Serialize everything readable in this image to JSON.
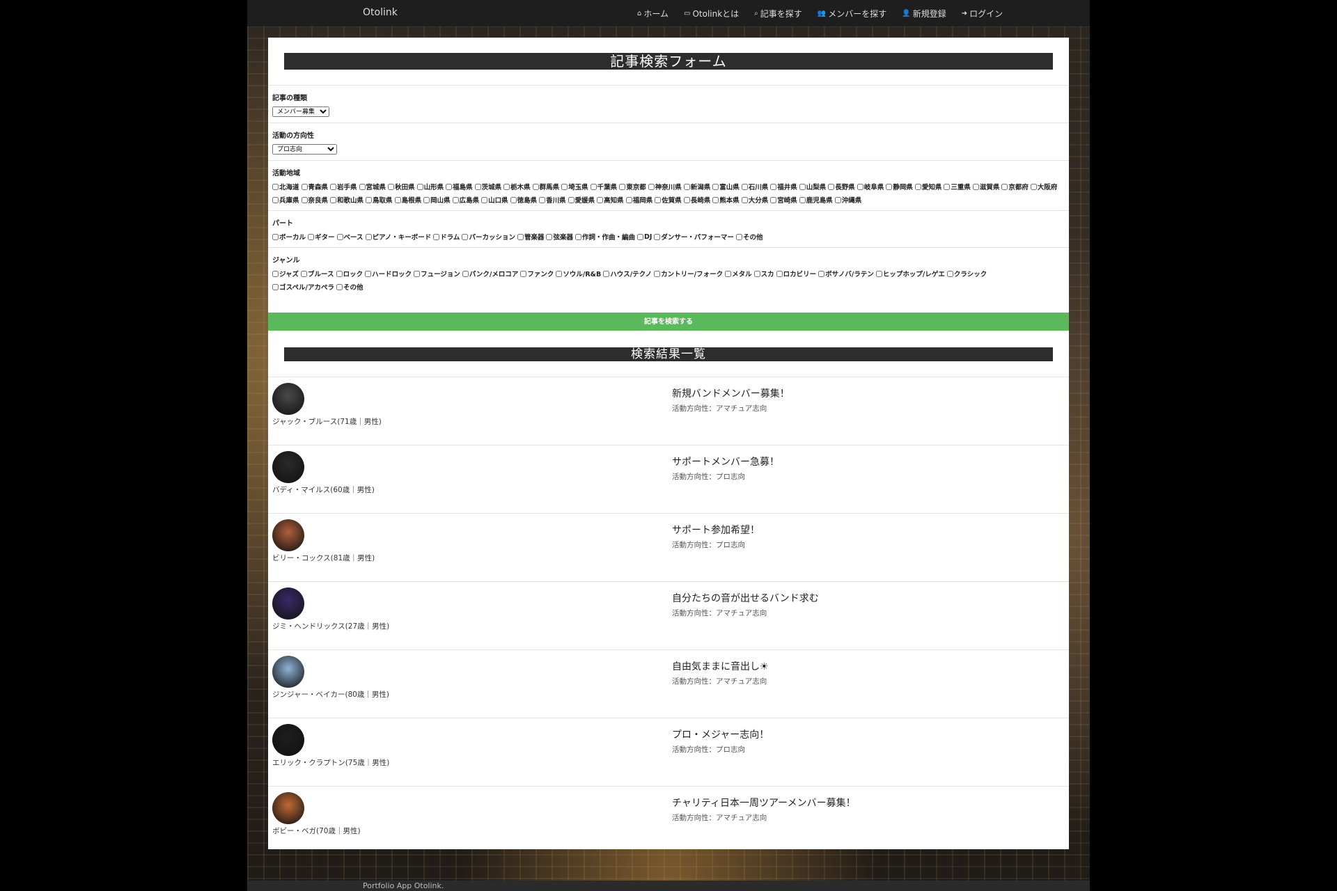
{
  "nav": {
    "brand": "Otolink",
    "links": [
      {
        "icon": "home-icon",
        "glyph": "⌂",
        "label": "ホーム"
      },
      {
        "icon": "document-icon",
        "glyph": "▭",
        "label": "Otolinkとは"
      },
      {
        "icon": "search-icon",
        "glyph": "⌕",
        "label": "記事を探す"
      },
      {
        "icon": "users-icon",
        "glyph": "👥",
        "label": "メンバーを探す"
      },
      {
        "icon": "user-plus-icon",
        "glyph": "👤",
        "label": "新規登録"
      },
      {
        "icon": "login-icon",
        "glyph": "➜",
        "label": "ログイン"
      }
    ]
  },
  "form": {
    "title": "記事検索フォーム",
    "article_type": {
      "label": "記事の種類",
      "selected": "メンバー募集"
    },
    "direction": {
      "label": "活動の方向性",
      "selected": "プロ志向"
    },
    "region": {
      "label": "活動地域",
      "options": [
        "北海道",
        "青森県",
        "岩手県",
        "宮城県",
        "秋田県",
        "山形県",
        "福島県",
        "茨城県",
        "栃木県",
        "群馬県",
        "埼玉県",
        "千葉県",
        "東京都",
        "神奈川県",
        "新潟県",
        "富山県",
        "石川県",
        "福井県",
        "山梨県",
        "長野県",
        "岐阜県",
        "静岡県",
        "愛知県",
        "三重県",
        "滋賀県",
        "京都府",
        "大阪府",
        "兵庫県",
        "奈良県",
        "和歌山県",
        "鳥取県",
        "島根県",
        "岡山県",
        "広島県",
        "山口県",
        "徳島県",
        "香川県",
        "愛媛県",
        "高知県",
        "福岡県",
        "佐賀県",
        "長崎県",
        "熊本県",
        "大分県",
        "宮崎県",
        "鹿児島県",
        "沖縄県"
      ]
    },
    "part": {
      "label": "パート",
      "options": [
        "ボーカル",
        "ギター",
        "ベース",
        "ピアノ・キーボード",
        "ドラム",
        "パーカッション",
        "管楽器",
        "弦楽器",
        "作詞・作曲・編曲",
        "DJ",
        "ダンサー・パフォーマー",
        "その他"
      ]
    },
    "genre": {
      "label": "ジャンル",
      "options": [
        "ジャズ",
        "ブルース",
        "ロック",
        "ハードロック",
        "フュージョン",
        "パンク/メロコア",
        "ファンク",
        "ソウル/R&B",
        "ハウス/テクノ",
        "カントリー/フォーク",
        "メタル",
        "スカ",
        "ロカビリー",
        "ボサノバ/ラテン",
        "ヒップホップ/レゲエ",
        "クラシック",
        "ゴスペル/アカペラ",
        "その他"
      ]
    },
    "submit_label": "記事を検索する"
  },
  "results": {
    "title": "検索結果一覧",
    "items": [
      {
        "member": "ジャック・ブルース(71歳｜男性)",
        "title": "新規バンドメンバー募集！",
        "direction": "活動方向性：アマチュア志向",
        "avatar_color": "#4a4a4a"
      },
      {
        "member": "バディ・マイルス(60歳｜男性)",
        "title": "サポートメンバー急募！",
        "direction": "活動方向性：プロ志向",
        "avatar_color": "#2a2a2a"
      },
      {
        "member": "ビリー・コックス(81歳｜男性)",
        "title": "サポート参加希望！",
        "direction": "活動方向性：プロ志向",
        "avatar_color": "#b0603a"
      },
      {
        "member": "ジミ・ヘンドリックス(27歳｜男性)",
        "title": "自分たちの音が出せるバンド求む",
        "direction": "活動方向性：アマチュア志向",
        "avatar_color": "#3a2a6a"
      },
      {
        "member": "ジンジャー・ベイカー(80歳｜男性)",
        "title": "自由気ままに音出し☀",
        "direction": "活動方向性：アマチュア志向",
        "avatar_color": "#8fb3d6"
      },
      {
        "member": "エリック・クラプトン(75歳｜男性)",
        "title": "プロ・メジャー志向！",
        "direction": "活動方向性：プロ志向",
        "avatar_color": "#1e1e1e"
      },
      {
        "member": "ボビー・ベガ(70歳｜男性)",
        "title": "チャリティ日本一周ツアーメンバー募集！",
        "direction": "活動方向性：アマチュア志向",
        "avatar_color": "#c26a35"
      }
    ]
  },
  "footer": {
    "text": "Portfolio App Otolink."
  }
}
